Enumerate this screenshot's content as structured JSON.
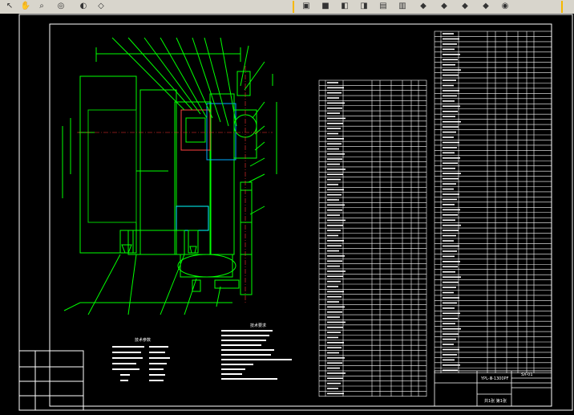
{
  "window": {
    "background": "#000000",
    "line_color": "#00ff00",
    "border_color": "#ffffff"
  },
  "toolbar": {
    "left_icons": [
      "arrow-icon",
      "pan-icon",
      "zoom-window-icon",
      "orbit-icon",
      "render-icon",
      "layer-icon"
    ],
    "right_icons": [
      "view-top-icon",
      "view-bottom-icon",
      "view-left-icon",
      "view-right-icon",
      "view-front-icon",
      "view-back-icon",
      "iso-sw-icon",
      "iso-se-icon",
      "iso-ne-icon",
      "iso-nw-icon",
      "camera-icon"
    ]
  },
  "tech_requirements": {
    "heading": "技术要求"
  },
  "technical_specs": {
    "heading": "技术参数"
  },
  "title_block": {
    "drawing_code": "SX-01",
    "drawing_title": "YPL-Ⅲ-1300PF",
    "sheet": "共1张 第1张"
  }
}
